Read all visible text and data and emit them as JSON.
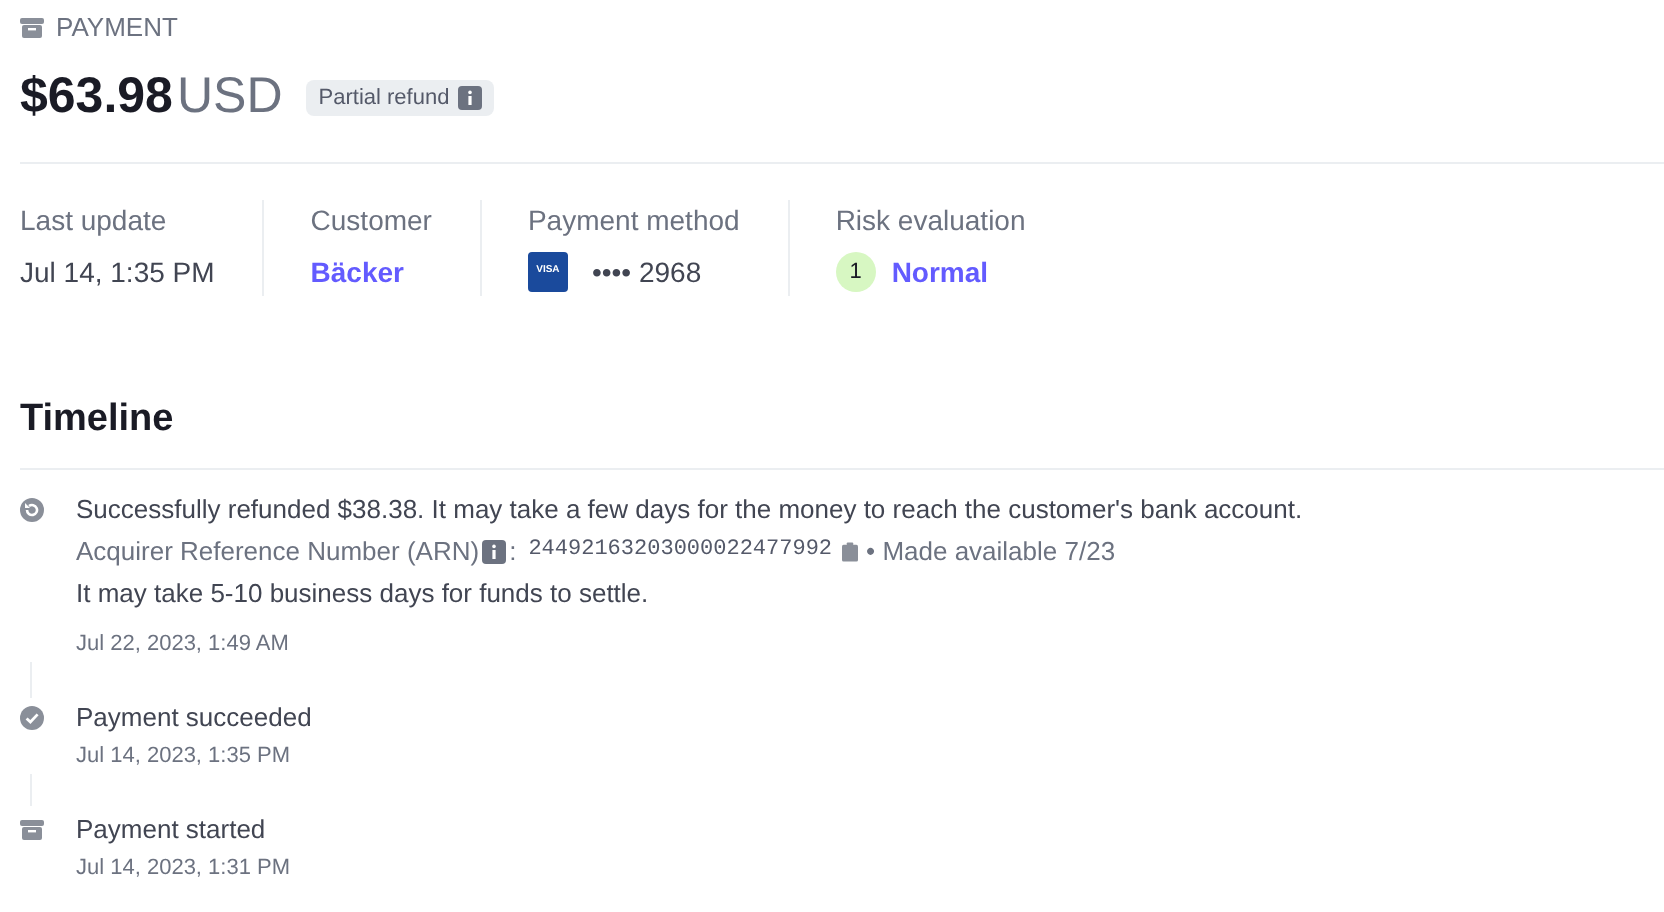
{
  "header": {
    "label": "PAYMENT",
    "amount": "$63.98",
    "currency": "USD",
    "badge": "Partial refund"
  },
  "details": [
    {
      "kind": "text",
      "label": "Last update",
      "value": "Jul 14, 1:35 PM"
    },
    {
      "kind": "link",
      "label": "Customer",
      "value": "Bäcker"
    },
    {
      "kind": "card",
      "label": "Payment method",
      "brand": "VISA",
      "value": "•••• 2968"
    },
    {
      "kind": "risk",
      "label": "Risk evaluation",
      "score": "1",
      "value": "Normal"
    }
  ],
  "timeline": {
    "title": "Timeline",
    "events": [
      {
        "kind": "refund",
        "text": "Successfully refunded $38.38. It may take a few days for the money to reach the customer's bank account.",
        "arn_label": "Acquirer Reference Number (ARN)",
        "arn_sep": ":",
        "arn": "24492163203000022477992",
        "available": "• Made available 7/23",
        "note": "It may take 5-10 business days for funds to settle.",
        "time": "Jul 22, 2023, 1:49 AM"
      },
      {
        "kind": "succeeded",
        "text": "Payment succeeded",
        "time": "Jul 14, 2023, 1:35 PM"
      },
      {
        "kind": "started",
        "text": "Payment started",
        "time": "Jul 14, 2023, 1:31 PM"
      }
    ]
  }
}
